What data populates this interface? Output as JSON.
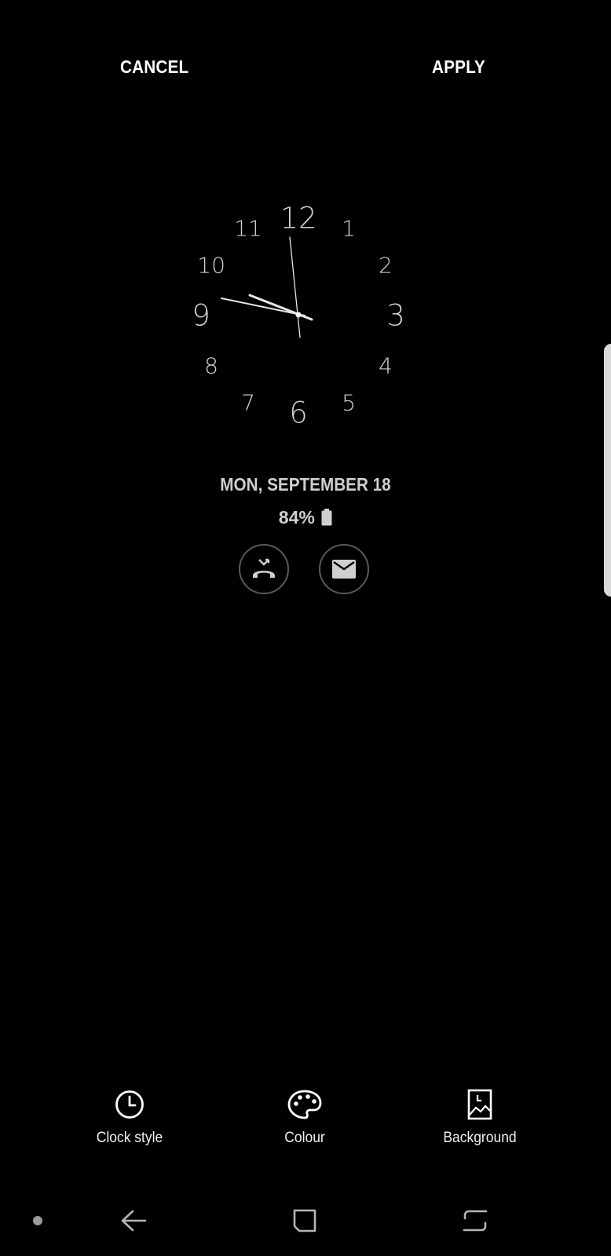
{
  "header": {
    "cancel_label": "CANCEL",
    "apply_label": "APPLY"
  },
  "clock": {
    "style": "analog",
    "numerals": [
      "12",
      "1",
      "2",
      "3",
      "4",
      "5",
      "6",
      "7",
      "8",
      "9",
      "10",
      "11"
    ]
  },
  "status": {
    "date": "MON, SEPTEMBER 18",
    "battery": "84%"
  },
  "notifications": [
    {
      "icon": "missed-call-icon"
    },
    {
      "icon": "email-icon"
    }
  ],
  "options": [
    {
      "label": "Clock style",
      "icon": "clock-icon"
    },
    {
      "label": "Colour",
      "icon": "palette-icon"
    },
    {
      "label": "Background",
      "icon": "image-icon"
    }
  ],
  "navbar": {
    "items": [
      "nav-dot",
      "back-icon",
      "home-icon",
      "recent-apps-icon"
    ]
  },
  "colors": {
    "background": "#000000",
    "text": "#ffffff",
    "secondary_text": "#cfcfcf"
  }
}
